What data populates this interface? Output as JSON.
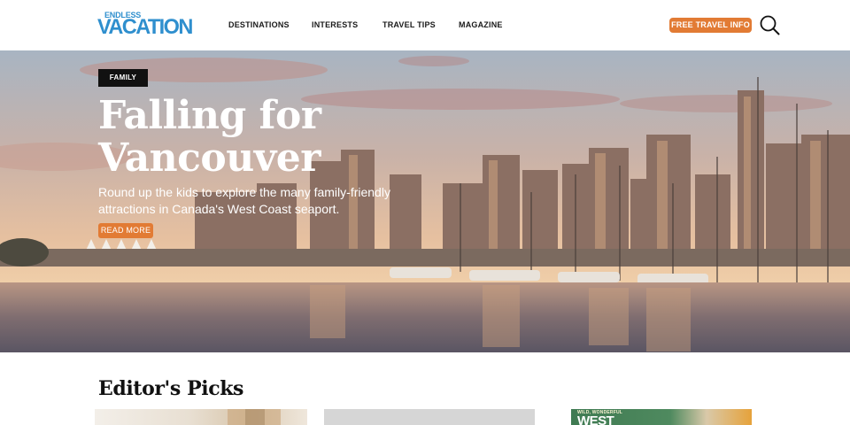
{
  "header": {
    "logo_top": "ENDLESS",
    "logo_main": "VACATION",
    "nav": [
      {
        "label": "DESTINATIONS"
      },
      {
        "label": "INTERESTS"
      },
      {
        "label": "TRAVEL TIPS"
      },
      {
        "label": "MAGAZINE"
      }
    ],
    "cta_label": "FREE TRAVEL INFO",
    "search_icon": "search-icon"
  },
  "hero": {
    "tag": "FAMILY",
    "title": "Falling for Vancouver",
    "subtitle": "Round up the kids to explore the many family-friendly attractions in Canada's West Coast seaport.",
    "button": "READ MORE"
  },
  "picks": {
    "title": "Editor's Picks",
    "cards": [
      {
        "kicker": "",
        "word": ""
      },
      {
        "kicker": "",
        "word": ""
      },
      {
        "kicker": "WILD, WONDERFUL",
        "word": "WEST"
      }
    ]
  },
  "colors": {
    "brand_blue": "#2f8fce",
    "accent_orange": "#e27b34",
    "tag_black": "#111111"
  }
}
